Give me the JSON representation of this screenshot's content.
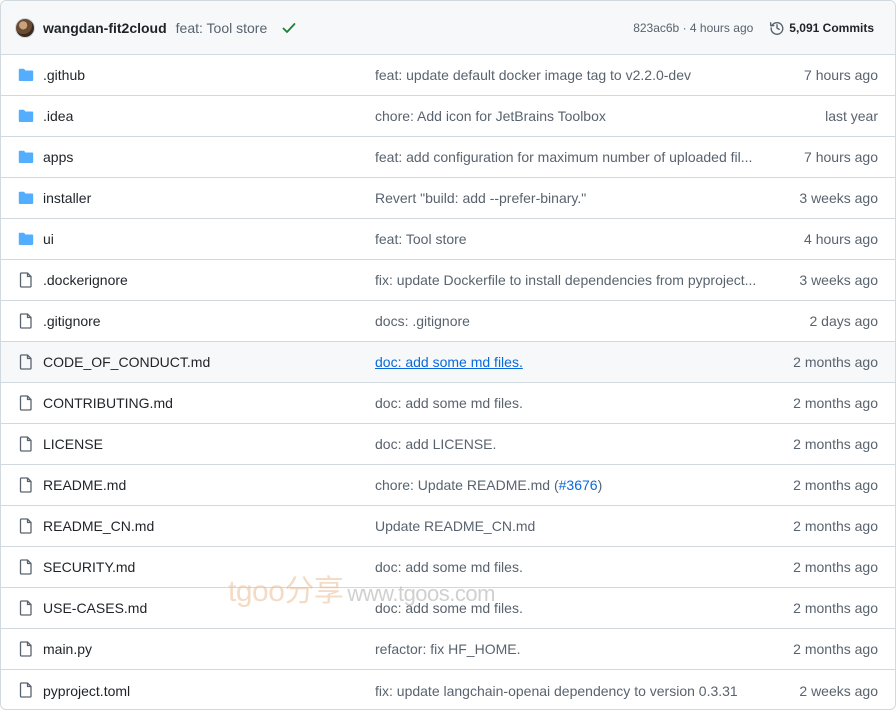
{
  "header": {
    "author": "wangdan-fit2cloud",
    "commit_message": "feat: Tool store",
    "commit_hash": "823ac6b",
    "commit_time": "4 hours ago",
    "hash_time_separator": " · ",
    "commits_label": "5,091 Commits",
    "status_color": "#1a7f37"
  },
  "files": [
    {
      "type": "folder",
      "name": ".github",
      "message": "feat: update default docker image tag to v2.2.0-dev",
      "time": "7 hours ago"
    },
    {
      "type": "folder",
      "name": ".idea",
      "message": "chore: Add icon for JetBrains Toolbox",
      "time": "last year"
    },
    {
      "type": "folder",
      "name": "apps",
      "message": "feat: add configuration for maximum number of uploaded fil...",
      "time": "7 hours ago"
    },
    {
      "type": "folder",
      "name": "installer",
      "message": "Revert \"build: add --prefer-binary.\"",
      "time": "3 weeks ago"
    },
    {
      "type": "folder",
      "name": "ui",
      "message": "feat: Tool store",
      "time": "4 hours ago"
    },
    {
      "type": "file",
      "name": ".dockerignore",
      "message": "fix: update Dockerfile to install dependencies from pyproject...",
      "time": "3 weeks ago"
    },
    {
      "type": "file",
      "name": ".gitignore",
      "message": "docs: .gitignore",
      "time": "2 days ago"
    },
    {
      "type": "file",
      "name": "CODE_OF_CONDUCT.md",
      "message": "doc: add some md files.",
      "time": "2 months ago"
    },
    {
      "type": "file",
      "name": "CONTRIBUTING.md",
      "message": "doc: add some md files.",
      "time": "2 months ago"
    },
    {
      "type": "file",
      "name": "LICENSE",
      "message": "doc: add LICENSE.",
      "time": "2 months ago"
    },
    {
      "type": "file",
      "name": "README.md",
      "message": "chore: Update README.md (",
      "message_pr": "#3676",
      "message_suffix": ")",
      "time": "2 months ago"
    },
    {
      "type": "file",
      "name": "README_CN.md",
      "message": "Update README_CN.md",
      "time": "2 months ago"
    },
    {
      "type": "file",
      "name": "SECURITY.md",
      "message": "doc: add some md files.",
      "time": "2 months ago"
    },
    {
      "type": "file",
      "name": "USE-CASES.md",
      "message": "doc: add some md files.",
      "time": "2 months ago"
    },
    {
      "type": "file",
      "name": "main.py",
      "message": "refactor: fix HF_HOME.",
      "time": "2 months ago"
    },
    {
      "type": "file",
      "name": "pyproject.toml",
      "message": "fix: update langchain-openai dependency to version 0.3.31",
      "time": "2 weeks ago"
    }
  ],
  "hovered_row": "CODE_OF_CONDUCT.md",
  "colors": {
    "folder_icon": "#54aeff",
    "file_icon": "#59636e",
    "link": "#0969da"
  },
  "watermark": {
    "brand": "tgoo分享",
    "site": "www.tgoos.com"
  }
}
